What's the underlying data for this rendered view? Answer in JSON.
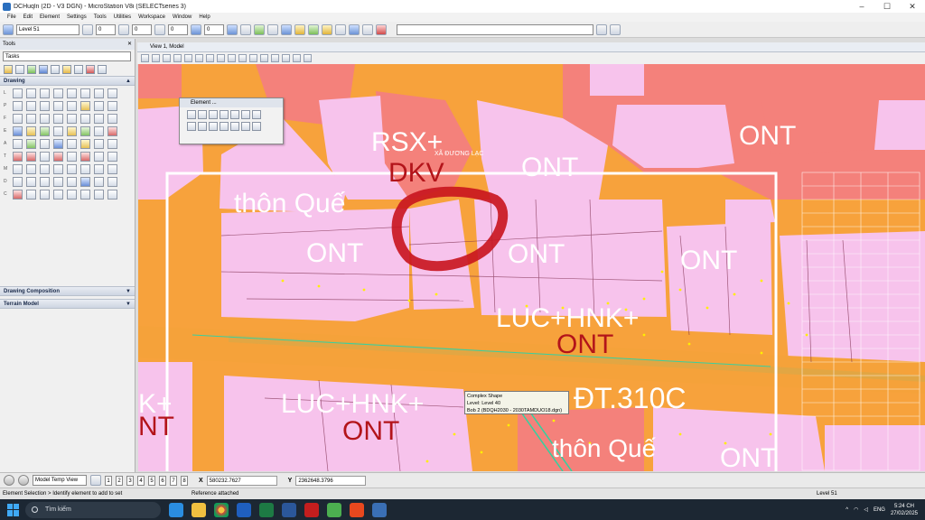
{
  "window": {
    "title": "DCHuqln (2D - V3 DGN) - MicroStation V8i (SELECTseries 3)",
    "minimize": "–",
    "maximize": "☐",
    "close": "✕"
  },
  "menu": [
    "File",
    "Edit",
    "Element",
    "Settings",
    "Tools",
    "Utilities",
    "Workspace",
    "Window",
    "Help"
  ],
  "toolbar": {
    "level_value": "Level 51",
    "combo_a": "0",
    "combo_b": "0",
    "combo_c": "0",
    "combo_d": "0"
  },
  "tools_panel": {
    "title": "Tools",
    "tasks_label": "Tasks",
    "drawing_label": "Drawing",
    "row_labels": [
      "L",
      "",
      "P",
      "",
      "F",
      "",
      "E",
      "",
      "A",
      "",
      "T",
      "",
      "M",
      "",
      "D",
      "",
      "C"
    ],
    "drawing_composition_label": "Drawing Composition",
    "terrain_model_label": "Terrain Model"
  },
  "view": {
    "title": "View 1, Model"
  },
  "element_box": {
    "title": "Element ..."
  },
  "map": {
    "zones": [
      {
        "text": "RSX+",
        "style": "white"
      },
      {
        "text": "DKV",
        "style": "red"
      },
      {
        "text": "ONT",
        "style": "white"
      },
      {
        "text": "ONT",
        "style": "white"
      },
      {
        "text": "thôn Quế",
        "style": "white"
      },
      {
        "text": "ONT",
        "style": "white"
      },
      {
        "text": "ONT",
        "style": "white"
      },
      {
        "text": "ONT",
        "style": "white"
      },
      {
        "text": "LUC+HNK+",
        "style": "white"
      },
      {
        "text": "ONT",
        "style": "red"
      },
      {
        "text": "LUC+HNK+",
        "style": "white"
      },
      {
        "text": "ONT",
        "style": "red"
      },
      {
        "text": "ĐT.310C",
        "style": "white"
      },
      {
        "text": "ONT",
        "style": "white"
      },
      {
        "text": "thôn Quế",
        "style": "white"
      },
      {
        "text": "K+",
        "style": "white"
      },
      {
        "text": "NT",
        "style": "red"
      },
      {
        "text": "XÃ ĐƯƠNG LẠC",
        "style": "white"
      }
    ],
    "highlight_color": "#c8141e",
    "land_pink": "#f7c3ec",
    "road_orange": "#f5a23a",
    "residential_red": "#f4817b"
  },
  "tooltip": {
    "line1": "Complex Shape",
    "line2": "Level: Level 40",
    "line3": "Bob 2 (BDQH2030 - 2030TAMDUO18.dgn)"
  },
  "coord_bar": {
    "view_combo": "Model Temp View",
    "view_tabs": [
      "1",
      "2",
      "3",
      "4",
      "5",
      "6",
      "7",
      "8"
    ],
    "x_label": "X",
    "x_value": "580232.7627",
    "y_label": "Y",
    "y_value": "2362648.3796"
  },
  "status_bar": {
    "prompt": "Element Selection > Identify element to add to set",
    "message": "Reference attached",
    "level": "Level 51"
  },
  "taskbar": {
    "search_placeholder": "Tìm kiếm",
    "language": "ENG",
    "time": "5:24 CH",
    "date": "27/02/2025"
  }
}
